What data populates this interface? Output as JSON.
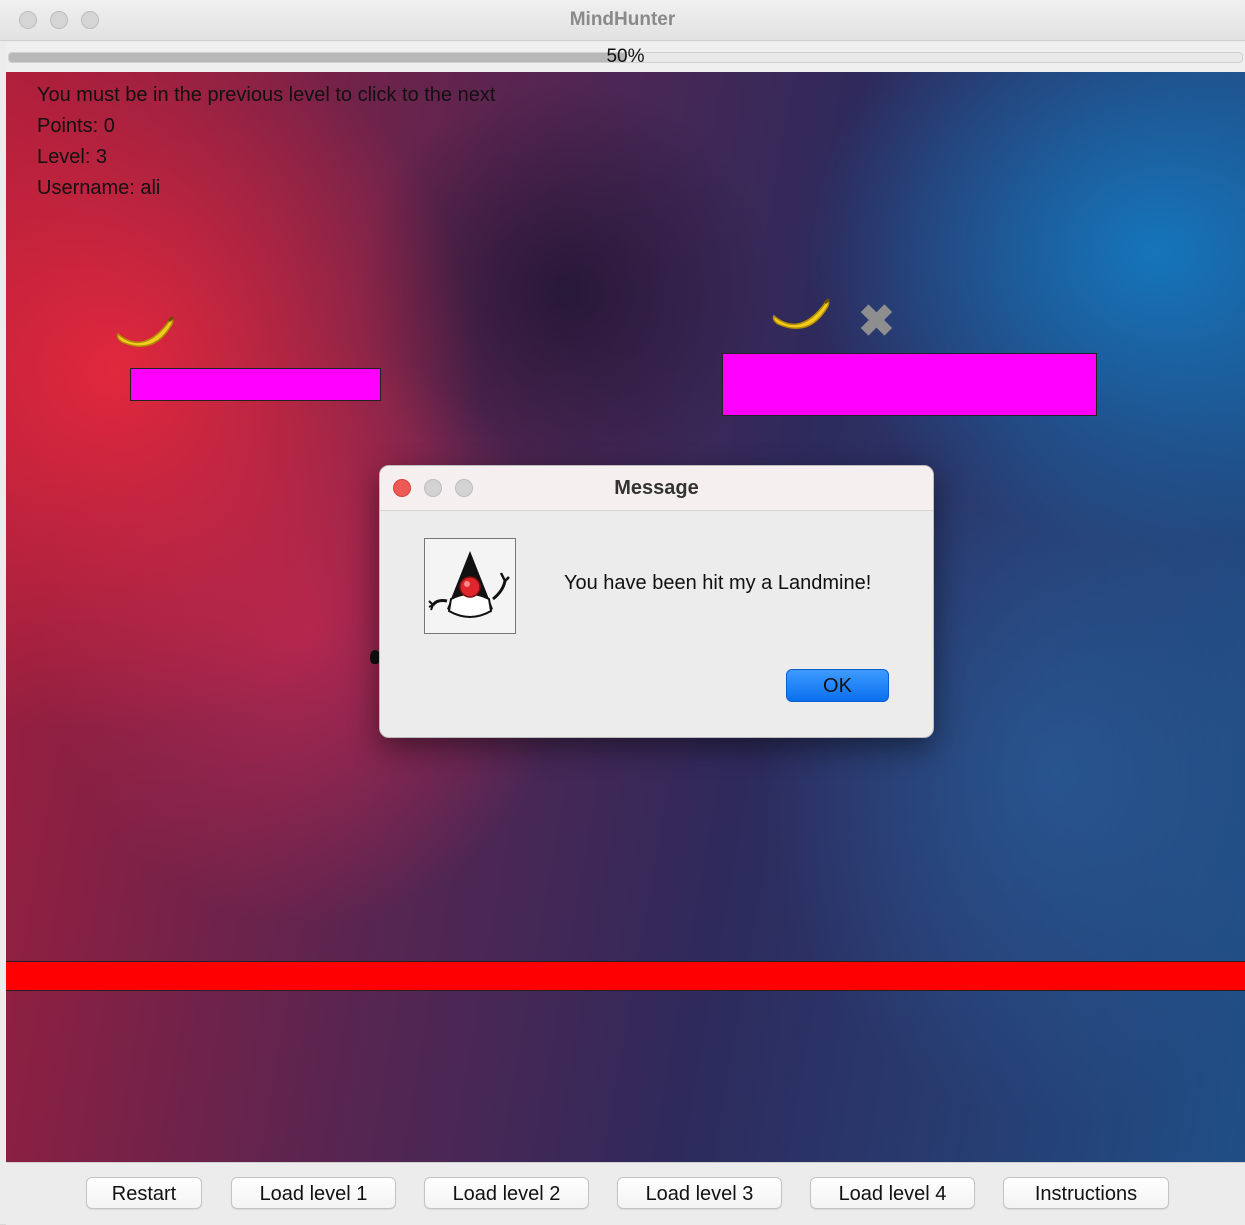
{
  "window": {
    "title": "MindHunter"
  },
  "progress": {
    "text": "50%",
    "value": 0.5
  },
  "hud": {
    "message": "You must be in the previous level to click to the next",
    "points": "Points: 0",
    "level": "Level: 3",
    "username": "Username: ali"
  },
  "game": {
    "platform_color": "#ff00ff",
    "lava_color": "#ff0000",
    "items": [
      {
        "icon": "banana-icon"
      },
      {
        "icon": "banana-icon"
      },
      {
        "icon": "x-mark-icon"
      }
    ]
  },
  "dialog": {
    "title": "Message",
    "message": "You have been hit my a Landmine!",
    "ok_label": "OK",
    "icon": "java-duke-icon"
  },
  "toolbar": {
    "buttons": [
      "Restart",
      "Load level 1",
      "Load level 2",
      "Load level 3",
      "Load level 4",
      "Instructions"
    ]
  },
  "colors": {
    "accent_button": "#0a6fee",
    "close_light": "#ed5a55"
  }
}
